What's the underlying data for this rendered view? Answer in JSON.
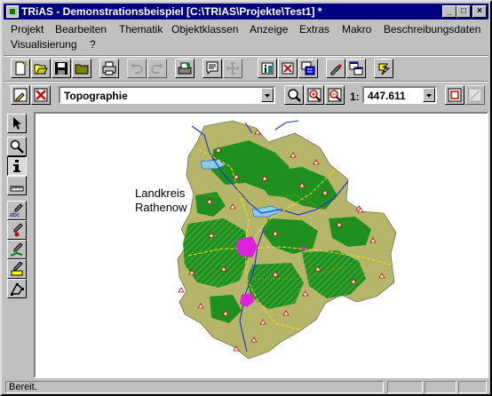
{
  "window": {
    "title": "TRiAS - Demonstrationsbeispiel [C:\\TRIAS\\Projekte\\Test1] *",
    "min_label": "_",
    "max_label": "□",
    "close_label": "×"
  },
  "menu": [
    {
      "label": "Projekt"
    },
    {
      "label": "Bearbeiten"
    },
    {
      "label": "Thematik"
    },
    {
      "label": "Objektklassen"
    },
    {
      "label": "Anzeige"
    },
    {
      "label": "Extras"
    },
    {
      "label": "Makro"
    },
    {
      "label": "Beschreibungsdaten"
    },
    {
      "label": "Visualisierung"
    },
    {
      "label": "?"
    }
  ],
  "toolbar": {
    "icons": [
      "new-icon",
      "open-icon",
      "save-icon",
      "folder-icon",
      "print-icon",
      "undo-icon",
      "redo-icon",
      "properties-icon",
      "notes-icon",
      "move-icon",
      "object-info-icon",
      "delete-object-icon",
      "object-list-icon",
      "edit-pen-icon",
      "windows-icon",
      "help-icon"
    ]
  },
  "view_toolbar": {
    "view_name": "Topographie",
    "scale_prefix": "1:",
    "scale_value": "447.611"
  },
  "tools": [
    "arrow-icon",
    "zoom-icon",
    "info-icon",
    "ruler-icon",
    "text-pen-icon",
    "point-pen-icon",
    "line-pen-icon",
    "area-pen-icon",
    "polygon-icon"
  ],
  "map": {
    "label_line1": "Landkreis",
    "label_line2": "Rathenow",
    "colors": {
      "land": "#b6b66a",
      "forest": "#1f8f1f",
      "water": "#87ceeb",
      "river": "#1e2fd0",
      "urban": "#e020e0",
      "road": "#ffe000"
    }
  },
  "status": {
    "text": "Bereit."
  }
}
